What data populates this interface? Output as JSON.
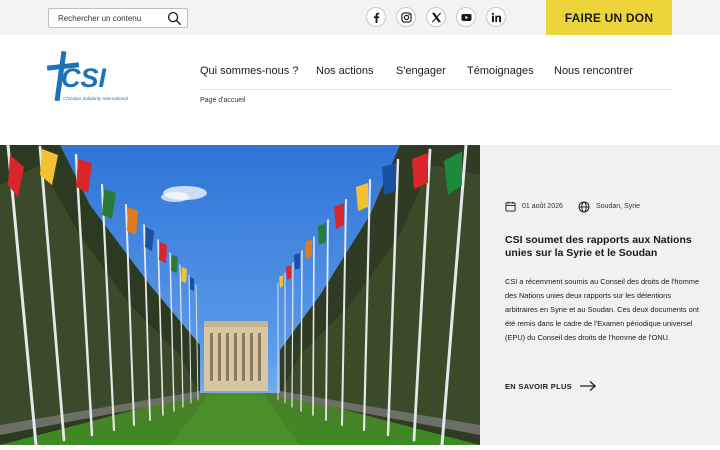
{
  "header": {
    "search": {
      "placeholder": "Rechercher un contenu",
      "value": ""
    },
    "socials": [
      {
        "name": "facebook",
        "icon": "facebook-icon"
      },
      {
        "name": "instagram",
        "icon": "instagram-icon"
      },
      {
        "name": "x",
        "icon": "x-icon"
      },
      {
        "name": "youtube",
        "icon": "youtube-icon"
      },
      {
        "name": "linkedin",
        "icon": "linkedin-icon"
      }
    ],
    "donate_label": "FAIRE UN DON",
    "donate_color": "#ecd53a",
    "topbar_color": "#f3f3f3"
  },
  "logo": {
    "wordmark": "CSI",
    "tagline": "Christian Solidarity International",
    "brand_color": "#1e73b8"
  },
  "nav": {
    "items": [
      {
        "label": "Qui sommes-nous ?"
      },
      {
        "label": "Nos actions"
      },
      {
        "label": "S'engager"
      },
      {
        "label": "Témoignages"
      },
      {
        "label": "Nous rencontrer"
      }
    ]
  },
  "breadcrumb": {
    "home_label": "Page d'accueil"
  },
  "article": {
    "date": "01 août 2026",
    "location": "Soudan, Syrie",
    "title": "CSI soumet des rapports aux Nations unies sur la Syrie et le Soudan",
    "summary": "CSI a récemment soumis au Conseil des droits de l'homme des Nations unies deux rapports sur les détentions arbitraires en Syrie et au Soudan. Ces deux documents ont été remis dans le cadre de l'Examen périodique universel (EPU) du Conseil des droits de l'homme de l'ONU.",
    "read_more_label": "EN SAVOIR PLUS",
    "card_color": "#f1f1f1"
  }
}
